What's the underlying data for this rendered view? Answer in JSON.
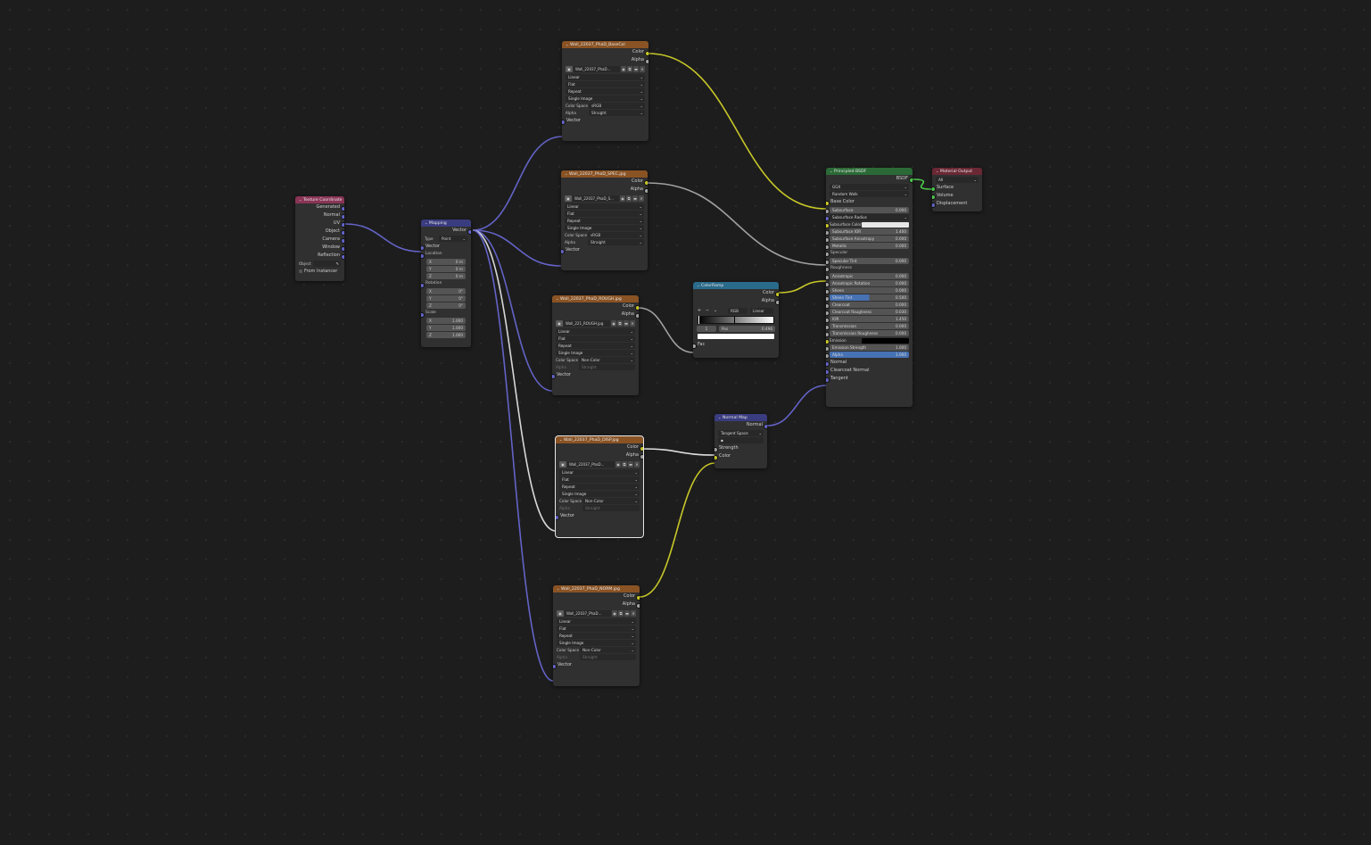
{
  "canvas": {
    "background": "#1d1d1d",
    "wire_colors": {
      "color": "#c7c729",
      "float": "#a1a1a1",
      "vector": "#6363c7",
      "shader": "#4dc74d"
    }
  },
  "nodes": {
    "texcoord": {
      "title": "Texture Coordinate",
      "outputs": [
        "Generated",
        "Normal",
        "UV",
        "Object",
        "Camera",
        "Window",
        "Reflection"
      ],
      "object_label": "Object",
      "from_instancer": "From Instancer"
    },
    "mapping": {
      "title": "Mapping",
      "output": "Vector",
      "type_label": "Type",
      "type_value": "Point",
      "inputs": {
        "vector": "Vector",
        "location": "Location",
        "rotation": "Rotation",
        "scale": "Scale"
      },
      "location": [
        {
          "axis": "X",
          "value": "0 m"
        },
        {
          "axis": "Y",
          "value": "0 m"
        },
        {
          "axis": "Z",
          "value": "0 m"
        }
      ],
      "rotation": [
        {
          "axis": "X",
          "value": "0°"
        },
        {
          "axis": "Y",
          "value": "0°"
        },
        {
          "axis": "Z",
          "value": "0°"
        }
      ],
      "scale": [
        {
          "axis": "X",
          "value": "1.000"
        },
        {
          "axis": "Y",
          "value": "1.000"
        },
        {
          "axis": "Z",
          "value": "1.000"
        }
      ]
    },
    "img_col": {
      "title": "Wall_22037_PhaD_BaseCol",
      "image": "Wall_22037_PhaD...",
      "interp": "Linear",
      "proj": "Flat",
      "ext": "Repeat",
      "src": "Single Image",
      "cs_label": "Color Space",
      "cs": "sRGB",
      "alpha_label": "Alpha",
      "alpha": "Straight",
      "out_color": "Color",
      "out_alpha": "Alpha",
      "in_vector": "Vector"
    },
    "img_spec": {
      "title": "Wall_22037_PhaD_SPEC.jpg",
      "image": "Wall_22037_PhaD_S...",
      "interp": "Linear",
      "proj": "Flat",
      "ext": "Repeat",
      "src": "Single Image",
      "cs_label": "Color Space",
      "cs": "sRGB",
      "alpha_label": "Alpha",
      "alpha": "Straight",
      "out_color": "Color",
      "out_alpha": "Alpha",
      "in_vector": "Vector"
    },
    "img_rough": {
      "title": "Wall_22037_PhaD_ROUGH.jpg",
      "image": "Wall_221_ROUGH.jpg",
      "interp": "Linear",
      "proj": "Flat",
      "ext": "Repeat",
      "src": "Single Image",
      "cs_label": "Color Space",
      "cs": "Non-Color",
      "alpha_label": "Alpha",
      "alpha": "Straight",
      "out_color": "Color",
      "out_alpha": "Alpha",
      "in_vector": "Vector"
    },
    "img_disp": {
      "title": "Wall_22037_PhaD_DISP.jpg",
      "image": "Wall_22037_PhaD...",
      "interp": "Linear",
      "proj": "Flat",
      "ext": "Repeat",
      "src": "Single Image",
      "cs_label": "Color Space",
      "cs": "Non-Color",
      "alpha_label": "Alpha",
      "alpha": "Straight",
      "out_color": "Color",
      "out_alpha": "Alpha",
      "in_vector": "Vector"
    },
    "img_norm": {
      "title": "Wall_22037_PhaD_NORM.jpg",
      "image": "Wall_22037_PhaD...",
      "interp": "Linear",
      "proj": "Flat",
      "ext": "Repeat",
      "src": "Single Image",
      "cs_label": "Color Space",
      "cs": "Non-Color",
      "alpha_label": "Alpha",
      "alpha": "Straight",
      "out_color": "Color",
      "out_alpha": "Alpha",
      "in_vector": "Vector"
    },
    "colorramp": {
      "title": "ColorRamp",
      "out_color": "Color",
      "out_alpha": "Alpha",
      "mode": "RGB",
      "interp": "Linear",
      "stop_index": "1",
      "pos_label": "Pos",
      "pos": "0.496",
      "in_fac": "Fac"
    },
    "normalmap": {
      "title": "Normal Map",
      "out_normal": "Normal",
      "space": "Tangent Space",
      "uv": "",
      "in_strength": "Strength",
      "in_color": "Color"
    },
    "bsdf": {
      "title": "Principled BSDF",
      "out": "BSDF",
      "distribution": "GGX",
      "subsurface_method": "Random Walk",
      "base_color": "Base Color",
      "params": [
        {
          "label": "Subsurface",
          "value": "0.000"
        },
        {
          "label": "Subsurface Radius",
          "value": ""
        },
        {
          "label": "Subsurface Color",
          "value": ""
        },
        {
          "label": "Subsurface IOR",
          "value": "1.400"
        },
        {
          "label": "Subsurface Anisotropy",
          "value": "0.000"
        },
        {
          "label": "Metallic",
          "value": "0.000"
        },
        {
          "label": "Specular",
          "value": ""
        },
        {
          "label": "Specular Tint",
          "value": "0.000"
        },
        {
          "label": "Roughness",
          "value": ""
        },
        {
          "label": "Anisotropic",
          "value": "0.000"
        },
        {
          "label": "Anisotropic Rotation",
          "value": "0.000"
        },
        {
          "label": "Sheen",
          "value": "0.000"
        },
        {
          "label": "Sheen Tint",
          "value": "0.500"
        },
        {
          "label": "Clearcoat",
          "value": "0.000"
        },
        {
          "label": "Clearcoat Roughness",
          "value": "0.030"
        },
        {
          "label": "IOR",
          "value": "1.450"
        },
        {
          "label": "Transmission",
          "value": "0.000"
        },
        {
          "label": "Transmission Roughness",
          "value": "0.000"
        },
        {
          "label": "Emission",
          "value": ""
        },
        {
          "label": "Emission Strength",
          "value": "1.000"
        },
        {
          "label": "Alpha",
          "value": "1.000"
        }
      ],
      "normal": "Normal",
      "clearcoat_normal": "Clearcoat Normal",
      "tangent": "Tangent"
    },
    "output": {
      "title": "Material Output",
      "target": "All",
      "inputs": [
        "Surface",
        "Volume",
        "Displacement"
      ]
    }
  }
}
